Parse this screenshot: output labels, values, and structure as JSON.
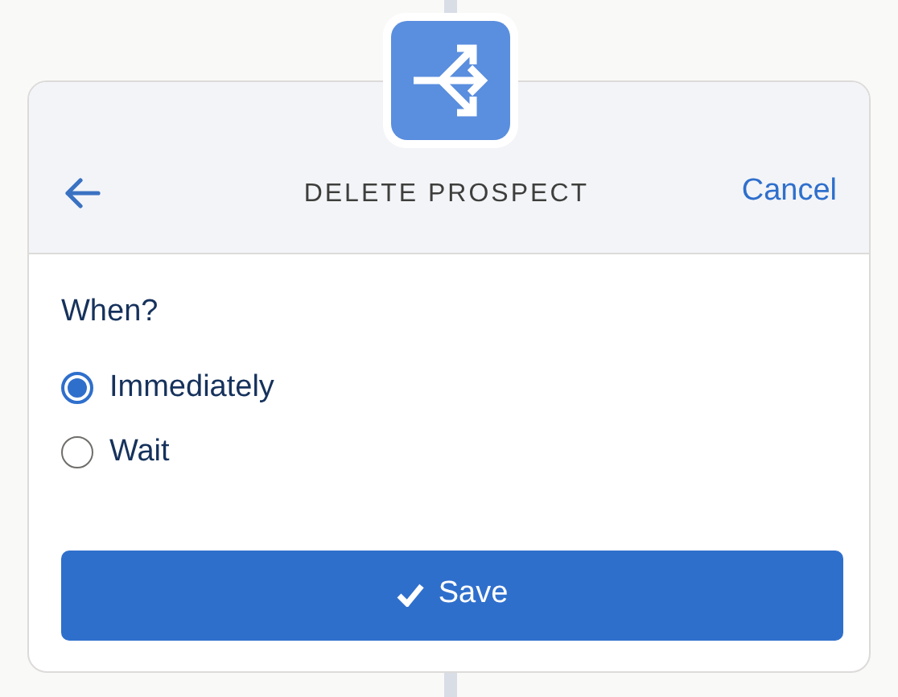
{
  "header": {
    "title": "DELETE PROSPECT",
    "cancel": "Cancel"
  },
  "question": "When?",
  "options": [
    {
      "label": "Immediately",
      "selected": true
    },
    {
      "label": "Wait",
      "selected": false
    }
  ],
  "save_button": {
    "label": "Save"
  }
}
